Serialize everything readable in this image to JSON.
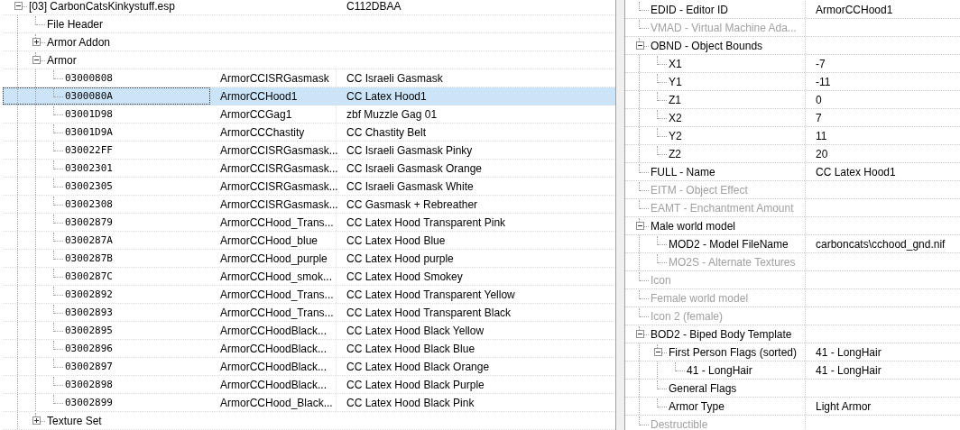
{
  "left_tree": {
    "label": "[03] CarbonCatsKinkystuff.esp",
    "value": "C112DBAA",
    "kind": "group",
    "expanded": true,
    "children": [
      {
        "label": "File Header",
        "kind": "leaf"
      },
      {
        "label": "Armor Addon",
        "kind": "group",
        "expanded": false
      },
      {
        "label": "Armor",
        "kind": "group",
        "expanded": true,
        "records": [
          {
            "form_id": "03000808",
            "editor_id": "ArmorCCISRGasmask",
            "name": "CC Israeli Gasmask",
            "selected": false
          },
          {
            "form_id": "0300080A",
            "editor_id": "ArmorCCHood1",
            "name": "CC Latex Hood1",
            "selected": true
          },
          {
            "form_id": "03001D98",
            "editor_id": "ArmorCCGag1",
            "name": "zbf Muzzle Gag 01",
            "selected": false
          },
          {
            "form_id": "03001D9A",
            "editor_id": "ArmorCCChastity",
            "name": "CC Chastity Belt",
            "selected": false
          },
          {
            "form_id": "030022FF",
            "editor_id": "ArmorCCISRGasmask...",
            "name": "CC Israeli Gasmask Pinky",
            "selected": false
          },
          {
            "form_id": "03002301",
            "editor_id": "ArmorCCISRGasmask...",
            "name": "CC Israeli Gasmask Orange",
            "selected": false
          },
          {
            "form_id": "03002305",
            "editor_id": "ArmorCCISRGasmask...",
            "name": "CC Israeli Gasmask White",
            "selected": false
          },
          {
            "form_id": "03002308",
            "editor_id": "ArmorCCISRGasmask...",
            "name": "CC Gasmask + Rebreather",
            "selected": false
          },
          {
            "form_id": "03002879",
            "editor_id": "ArmorCCHood_Trans...",
            "name": "CC Latex Hood Transparent Pink",
            "selected": false
          },
          {
            "form_id": "0300287A",
            "editor_id": "ArmorCCHood_blue",
            "name": "CC Latex Hood Blue",
            "selected": false
          },
          {
            "form_id": "0300287B",
            "editor_id": "ArmorCCHood_purple",
            "name": "CC Latex Hood purple",
            "selected": false
          },
          {
            "form_id": "0300287C",
            "editor_id": "ArmorCCHood_smok...",
            "name": "CC Latex Hood Smokey",
            "selected": false
          },
          {
            "form_id": "03002892",
            "editor_id": "ArmorCCHood_Trans...",
            "name": "CC Latex Hood Transparent Yellow",
            "selected": false
          },
          {
            "form_id": "03002893",
            "editor_id": "ArmorCCHood_Trans...",
            "name": "CC Latex Hood Transparent Black",
            "selected": false
          },
          {
            "form_id": "03002895",
            "editor_id": "ArmorCCHoodBlack...",
            "name": "CC Latex Hood Black Yellow",
            "selected": false
          },
          {
            "form_id": "03002896",
            "editor_id": "ArmorCCHoodBlack...",
            "name": "CC Latex Hood Black Blue",
            "selected": false
          },
          {
            "form_id": "03002897",
            "editor_id": "ArmorCCHoodBlack...",
            "name": "CC Latex Hood Black Orange",
            "selected": false
          },
          {
            "form_id": "03002898",
            "editor_id": "ArmorCCHoodBlack...",
            "name": "CC Latex Hood Black Purple",
            "selected": false
          },
          {
            "form_id": "03002899",
            "editor_id": "ArmorCCHood_Black...",
            "name": "CC Latex Hood Black Pink",
            "selected": false
          }
        ]
      },
      {
        "label": "Texture Set",
        "kind": "group",
        "expanded": false
      }
    ]
  },
  "record_view": [
    {
      "label": "EDID - Editor ID",
      "value": "ArmorCCHood1",
      "disabled": false,
      "kind": "leaf"
    },
    {
      "label": "VMAD - Virtual Machine Ada...",
      "disabled": true,
      "kind": "leaf"
    },
    {
      "label": "OBND - Object Bounds",
      "disabled": false,
      "kind": "group",
      "expanded": true,
      "children": [
        {
          "label": "X1",
          "value": "-7",
          "disabled": false,
          "kind": "leaf"
        },
        {
          "label": "Y1",
          "value": "-11",
          "disabled": false,
          "kind": "leaf"
        },
        {
          "label": "Z1",
          "value": "0",
          "disabled": false,
          "kind": "leaf"
        },
        {
          "label": "X2",
          "value": "7",
          "disabled": false,
          "kind": "leaf"
        },
        {
          "label": "Y2",
          "value": "11",
          "disabled": false,
          "kind": "leaf"
        },
        {
          "label": "Z2",
          "value": "20",
          "disabled": false,
          "kind": "leaf"
        }
      ]
    },
    {
      "label": "FULL - Name",
      "value": "CC Latex Hood1",
      "disabled": false,
      "kind": "leaf"
    },
    {
      "label": "EITM - Object Effect",
      "disabled": true,
      "kind": "leaf"
    },
    {
      "label": "EAMT - Enchantment Amount",
      "disabled": true,
      "kind": "leaf"
    },
    {
      "label": "Male world model",
      "disabled": false,
      "kind": "group",
      "expanded": true,
      "children": [
        {
          "label": "MOD2 - Model FileName",
          "value": "carboncats\\cchood_gnd.nif",
          "disabled": false,
          "kind": "leaf"
        },
        {
          "label": "MO2S - Alternate Textures",
          "disabled": true,
          "kind": "leaf"
        }
      ]
    },
    {
      "label": "Icon",
      "disabled": true,
      "kind": "leaf"
    },
    {
      "label": "Female world model",
      "disabled": true,
      "kind": "leaf"
    },
    {
      "label": "Icon 2 (female)",
      "disabled": true,
      "kind": "leaf"
    },
    {
      "label": "BOD2 - Biped Body Template",
      "disabled": false,
      "kind": "group",
      "expanded": true,
      "children": [
        {
          "label": "First Person Flags (sorted)",
          "value": "41 - LongHair",
          "disabled": false,
          "kind": "group",
          "expanded": true,
          "children": [
            {
              "label": "41 - LongHair",
              "value": "41 - LongHair",
              "disabled": false,
              "kind": "leaf"
            }
          ]
        },
        {
          "label": "General Flags",
          "disabled": false,
          "kind": "leaf"
        },
        {
          "label": "Armor Type",
          "value": "Light Armor",
          "disabled": false,
          "kind": "leaf"
        }
      ]
    },
    {
      "label": "Destructible",
      "disabled": true,
      "kind": "leaf"
    }
  ]
}
